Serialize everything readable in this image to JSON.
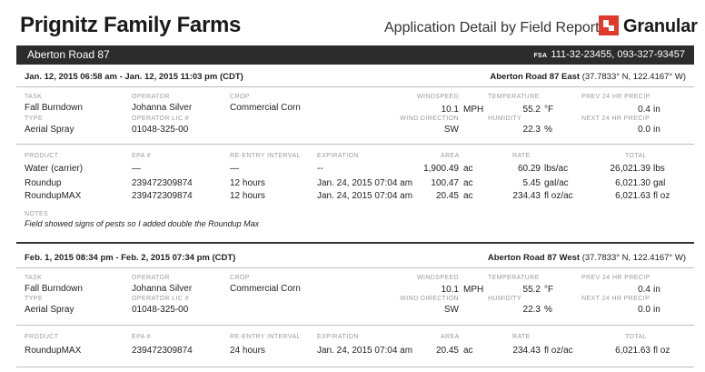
{
  "header": {
    "farm_name": "Prignitz Family Farms",
    "report_title": "Application Detail by Field Report",
    "brand": "Granular",
    "brand_color": "#e03a2d",
    "logo_icon": "granular-logo-icon"
  },
  "field": {
    "name": "Aberton Road 87",
    "fsa_label": "FSA",
    "fsa_value": "111-32-23455, 093-327-93457"
  },
  "labels": {
    "task": "TASK",
    "type": "TYPE",
    "operator": "OPERATOR",
    "operator_lic": "OPERATOR LIC #",
    "crop": "CROP",
    "windspeed": "WINDSPEED",
    "wind_direction": "WIND DIRECTION",
    "temperature": "TEMPERATURE",
    "humidity": "HUMIDITY",
    "prev_precip": "PREV 24 HR PRECIP",
    "next_precip": "NEXT 24 HR PRECIP",
    "product": "PRODUCT",
    "epa": "EPA #",
    "reentry": "RE-ENTRY INTERVAL",
    "expiration": "EXPIRATION",
    "area": "AREA",
    "rate": "RATE",
    "total": "TOTAL",
    "notes": "NOTES"
  },
  "applications": [
    {
      "date_range": "Jan. 12, 2015 06:58 am - Jan. 12, 2015 11:03 pm (CDT)",
      "subfield": "Aberton Road 87 East",
      "coords": "(37.7833° N, 122.4167° W)",
      "task": "Fall Burndown",
      "type": "Aerial Spray",
      "operator": "Johanna Silver",
      "operator_lic": "01048-325-00",
      "crop": "Commercial Corn",
      "windspeed": "10.1",
      "windspeed_unit": "MPH",
      "wind_direction": "SW",
      "temperature": "55.2",
      "temperature_unit": "°F",
      "humidity": "22.3",
      "humidity_unit": "%",
      "prev_precip": "0.4",
      "prev_precip_unit": "in",
      "next_precip": "0.0",
      "next_precip_unit": "in",
      "products": [
        {
          "product": "Water (carrier)",
          "epa": "—",
          "reentry": "—",
          "expiration": "--",
          "area": "1,900.49",
          "area_unit": "ac",
          "rate": "60.29",
          "rate_unit": "lbs/ac",
          "total": "26,021.39",
          "total_unit": "lbs"
        },
        {
          "product": "Roundup",
          "epa": "239472309874",
          "reentry": "12 hours",
          "expiration": "Jan. 24, 2015 07:04 am",
          "area": "100.47",
          "area_unit": "ac",
          "rate": "5.45",
          "rate_unit": "gal/ac",
          "total": "6,021.30",
          "total_unit": "gal"
        },
        {
          "product": "RoundupMAX",
          "epa": "239472309874",
          "reentry": "12 hours",
          "expiration": "Jan. 24, 2015 07:04 am",
          "area": "20.45",
          "area_unit": "ac",
          "rate": "234.43",
          "rate_unit": "fl oz/ac",
          "total": "6,021.63",
          "total_unit": "fl oz"
        }
      ],
      "notes": "Field showed signs of pests so I added double the Roundup Max"
    },
    {
      "date_range": "Feb. 1, 2015 08:34 pm - Feb. 2, 2015 07:34 pm (CDT)",
      "subfield": "Aberton Road 87 West",
      "coords": "(37.7833° N, 122.4167° W)",
      "task": "Fall Burndown",
      "type": "Aerial Spray",
      "operator": "Johanna Silver",
      "operator_lic": "01048-325-00",
      "crop": "Commercial Corn",
      "windspeed": "10.1",
      "windspeed_unit": "MPH",
      "wind_direction": "SW",
      "temperature": "55.2",
      "temperature_unit": "°F",
      "humidity": "22.3",
      "humidity_unit": "%",
      "prev_precip": "0.4",
      "prev_precip_unit": "in",
      "next_precip": "0.0",
      "next_precip_unit": "in",
      "products": [
        {
          "product": "RoundupMAX",
          "epa": "239472309874",
          "reentry": "24 hours",
          "expiration": "Jan. 24, 2015 07:04 am",
          "area": "20.45",
          "area_unit": "ac",
          "rate": "234.43",
          "rate_unit": "fl oz/ac",
          "total": "6,021.63",
          "total_unit": "fl oz"
        }
      ]
    }
  ]
}
